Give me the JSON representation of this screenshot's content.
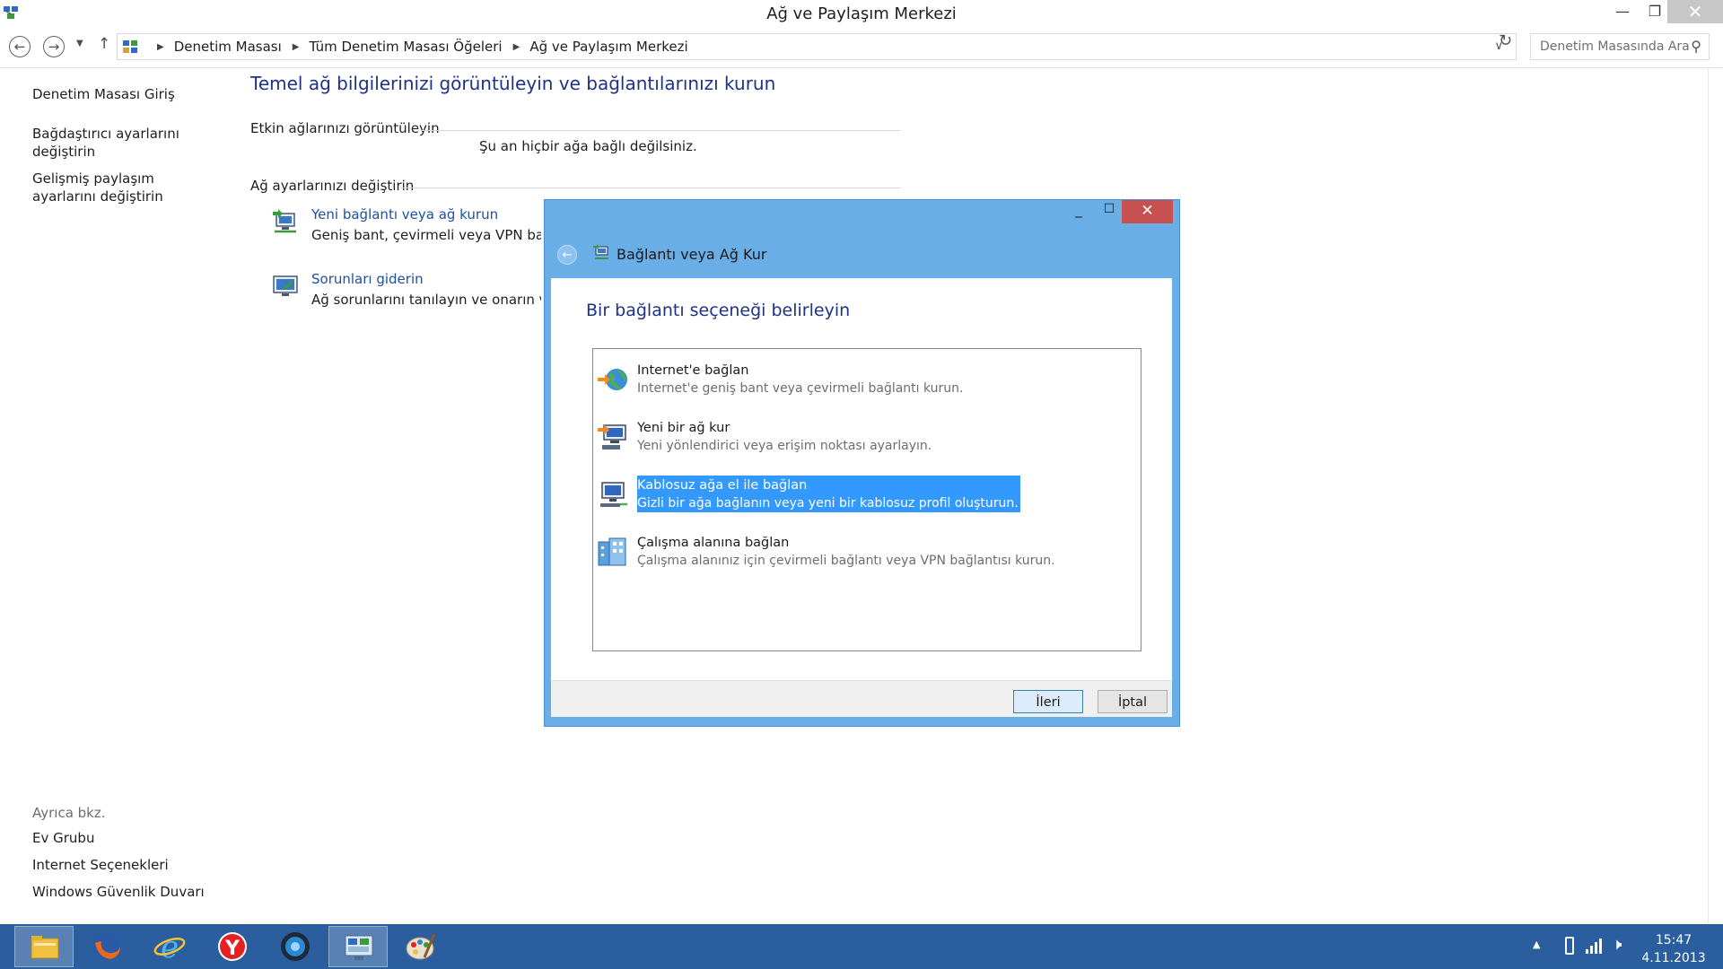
{
  "window": {
    "title": "Ağ ve Paylaşım Merkezi"
  },
  "address_bar": {
    "breadcrumbs": [
      "Denetim Masası",
      "Tüm Denetim Masası Öğeleri",
      "Ağ ve Paylaşım Merkezi"
    ],
    "search_placeholder": "Denetim Masasında Ara"
  },
  "left_nav": {
    "home": "Denetim Masası Giriş",
    "items": [
      {
        "label": "Bağdaştırıcı ayarlarını değiştirin"
      },
      {
        "label": "Gelişmiş paylaşım ayarlarını değiştirin"
      }
    ],
    "see_also": {
      "header": "Ayrıca bkz.",
      "links": [
        "Ev Grubu",
        "Internet Seçenekleri",
        "Windows Güvenlik Duvarı"
      ]
    }
  },
  "main": {
    "title": "Temel ağ bilgilerinizi görüntüleyin ve bağlantılarınızı kurun",
    "active_networks_header": "Etkin ağlarınızı görüntüleyin",
    "no_connection": "Şu an hiçbir ağa bağlı değilsiniz.",
    "change_settings_header": "Ağ ayarlarınızı değiştirin",
    "tasks": [
      {
        "link": "Yeni bağlantı veya ağ kurun",
        "description": "Geniş bant, çevirmeli veya VPN bağlant"
      },
      {
        "link": "Sorunları giderin",
        "description": "Ağ sorunlarını tanılayın ve onarın veya s"
      }
    ]
  },
  "dialog": {
    "title": "Bağlantı veya Ağ Kur",
    "heading": "Bir bağlantı seçeneği belirleyin",
    "options": [
      {
        "name": "Internet'e bağlan",
        "description": "Internet'e geniş bant veya çevirmeli bağlantı kurun.",
        "icon": "globe-icon",
        "selected": false
      },
      {
        "name": "Yeni bir ağ kur",
        "description": "Yeni yönlendirici veya erişim noktası ayarlayın.",
        "icon": "router-icon",
        "selected": false
      },
      {
        "name": "Kablosuz ağa el ile bağlan",
        "description": "Gizli bir ağa bağlanın veya yeni bir kablosuz profil oluşturun.",
        "icon": "wireless-monitor-icon",
        "selected": true
      },
      {
        "name": "Çalışma alanına bağlan",
        "description": "Çalışma alanınız için çevirmeli bağlantı veya VPN bağlantısı kurun.",
        "icon": "building-icon",
        "selected": false
      }
    ],
    "buttons": {
      "next": "İleri",
      "cancel": "İptal"
    }
  },
  "taskbar": {
    "apps": [
      "file-explorer-icon",
      "firefox-icon",
      "internet-explorer-icon",
      "yandex-browser-icon",
      "media-player-icon",
      "control-panel-icon",
      "paint-icon"
    ],
    "clock_time": "15:47",
    "clock_date": "4.11.2013"
  },
  "colors": {
    "accent_title": "#1e3287",
    "link": "#1e50a0",
    "dialog_frame": "#6aaee8",
    "selection": "#3399ff",
    "taskbar": "#2b5e9e",
    "close_button": "#c75050"
  }
}
